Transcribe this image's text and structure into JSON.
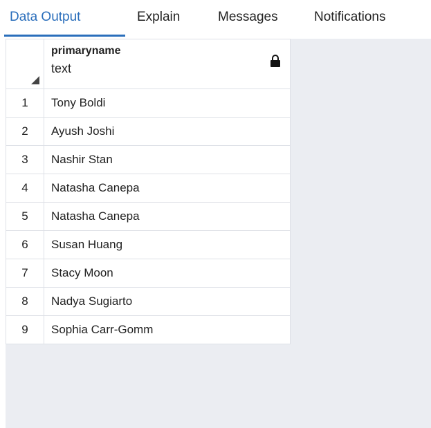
{
  "tabs": [
    {
      "label": "Data Output",
      "active": true
    },
    {
      "label": "Explain",
      "active": false
    },
    {
      "label": "Messages",
      "active": false
    },
    {
      "label": "Notifications",
      "active": false
    }
  ],
  "grid": {
    "column": {
      "name": "primaryname",
      "type": "text",
      "icon": "lock-icon"
    },
    "rows": [
      {
        "num": "1",
        "value": "Tony Boldi"
      },
      {
        "num": "2",
        "value": "Ayush Joshi"
      },
      {
        "num": "3",
        "value": "Nashir Stan"
      },
      {
        "num": "4",
        "value": "Natasha Canepa"
      },
      {
        "num": "5",
        "value": "Natasha Canepa"
      },
      {
        "num": "6",
        "value": "Susan Huang"
      },
      {
        "num": "7",
        "value": "Stacy Moon"
      },
      {
        "num": "8",
        "value": "Nadya Sugiarto"
      },
      {
        "num": "9",
        "value": "Sophia Carr-Gomm"
      }
    ]
  },
  "colors": {
    "accent": "#2a6ebb",
    "empty_area": "#ebedf2"
  }
}
